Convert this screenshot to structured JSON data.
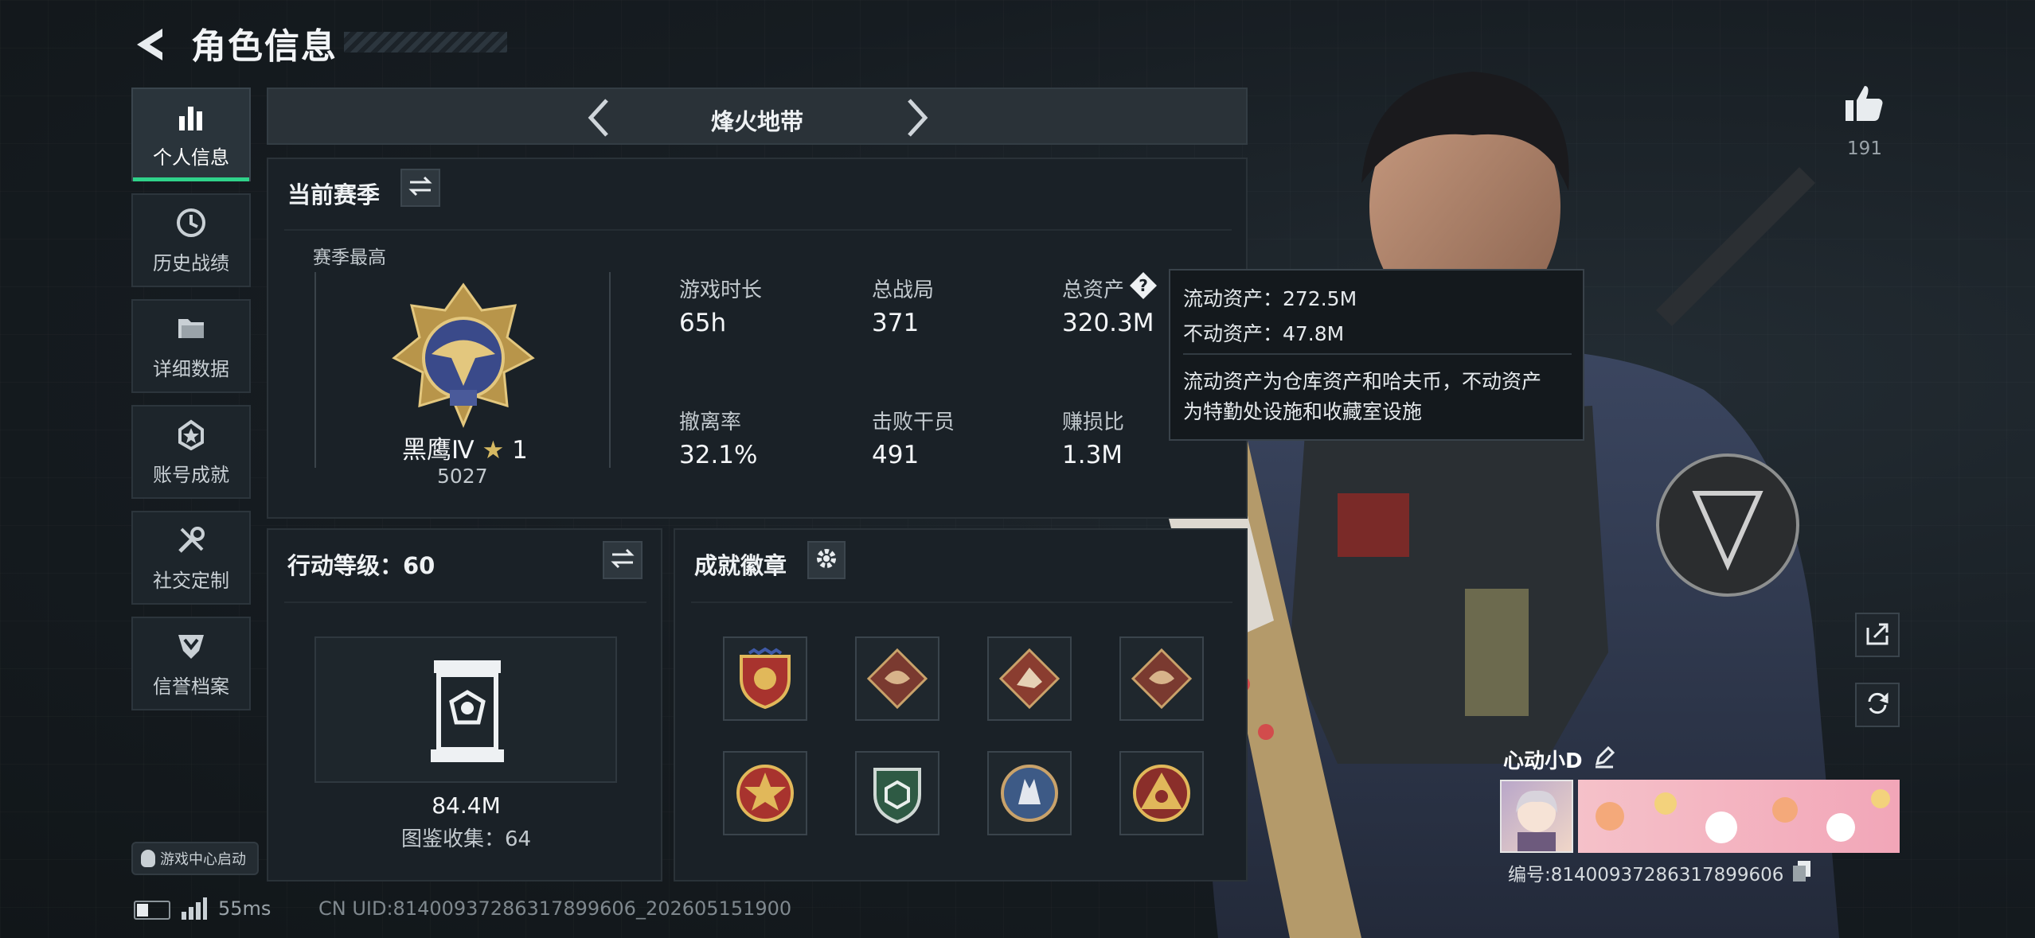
{
  "header": {
    "title": "角色信息"
  },
  "sidebar": {
    "items": [
      {
        "label": "个人信息",
        "icon": "bar-chart-icon",
        "active": true
      },
      {
        "label": "历史战绩",
        "icon": "history-clock-icon"
      },
      {
        "label": "详细数据",
        "icon": "folder-icon"
      },
      {
        "label": "账号成就",
        "icon": "achievement-medal-icon"
      },
      {
        "label": "社交定制",
        "icon": "tools-icon"
      },
      {
        "label": "信誉档案",
        "icon": "credit-shield-icon"
      }
    ],
    "launch": "游戏中心启动"
  },
  "mode": {
    "label": "烽火地带"
  },
  "season": {
    "title": "当前赛季",
    "best_label": "赛季最高",
    "rank_name": "黑鹰Ⅳ",
    "rank_stars": "1",
    "rank_score": "5027",
    "stats": [
      {
        "label": "游戏时长",
        "value": "65h"
      },
      {
        "label": "总战局",
        "value": "371"
      },
      {
        "label": "总资产",
        "value": "320.3M"
      },
      {
        "label": "撤离率",
        "value": "32.1%"
      },
      {
        "label": "击败干员",
        "value": "491"
      },
      {
        "label": "赚损比",
        "value": "1.3M"
      }
    ]
  },
  "tooltip": {
    "liquid": "流动资产：272.5M",
    "fixed": "不动资产：47.8M",
    "desc1": "流动资产为仓库资产和哈夫币，不动资产",
    "desc2": "为特勤处设施和收藏室设施"
  },
  "action": {
    "title": "行动等级：60",
    "value": "84.4M",
    "collect": "图鉴收集：64"
  },
  "achv": {
    "title": "成就徽章",
    "badges": [
      "eagle-shield-badge-icon",
      "dragon-badge-icon",
      "rider-badge-icon",
      "dragon-badge-icon",
      "star-emblem-badge-icon",
      "green-shield-badge-icon",
      "wolf-badge-icon",
      "triangle-eye-badge-icon"
    ]
  },
  "likes": {
    "count": "191"
  },
  "player": {
    "name": "心动小D",
    "id": "编号:81400937286317899606"
  },
  "status": {
    "ping": "55ms",
    "uid": "CN UID:81400937286317899606_202605151900"
  },
  "colors": {
    "accent": "#2fd28a",
    "panel": "#1a2127",
    "border": "#2a3238"
  }
}
